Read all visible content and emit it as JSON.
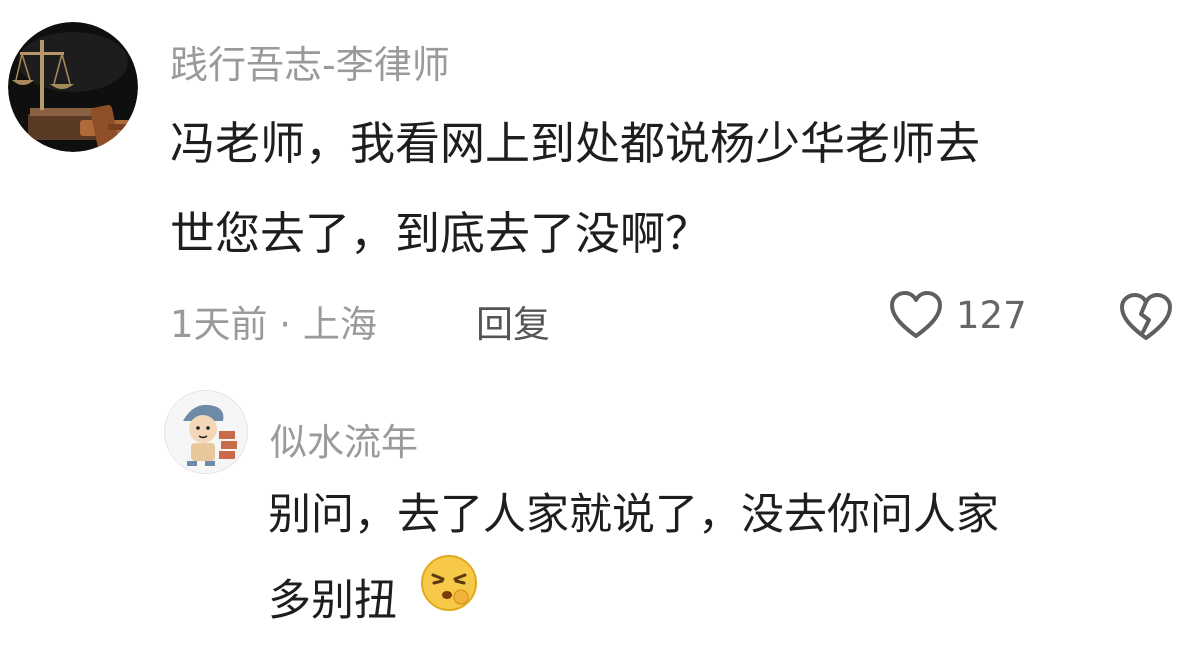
{
  "comment": {
    "username": "践行吾志-李律师",
    "line1": "冯老师，我看网上到处都说杨少华老师去",
    "line2": "世您去了，到底去了没啊？",
    "time_location": "1天前 · 上海",
    "reply_label": "回复",
    "like_count": "127"
  },
  "reply": {
    "username": "似水流年",
    "line1": "别问，去了人家就说了，没去你问人家",
    "line2": "多别扭",
    "emoji": "pouting-face-emoji"
  },
  "icons": {
    "like": "heart-outline-icon",
    "dislike": "broken-heart-icon"
  },
  "colors": {
    "username": "#9a9a9a",
    "text": "#1e1e1e",
    "icon": "#666666"
  }
}
